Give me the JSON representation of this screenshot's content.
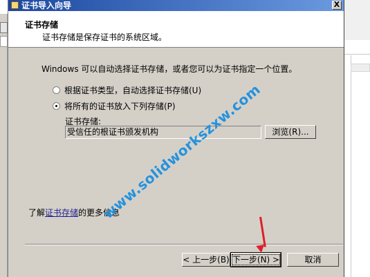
{
  "dialog": {
    "title": "证书导入向导",
    "close_label": "X"
  },
  "header": {
    "title": "证书存储",
    "subtitle": "证书存储是保存证书的系统区域。"
  },
  "body": {
    "intro": "Windows 可以自动选择证书存储，或者您可以为证书指定一个位置。",
    "options": [
      {
        "label": "根据证书类型，自动选择证书存储(U)",
        "checked": false
      },
      {
        "label": "将所有的证书放入下列存储(P)",
        "checked": true
      }
    ],
    "store_label": "证书存储:",
    "store_value": "受信任的根证书颁发机构",
    "browse_label": "浏览(R)..."
  },
  "learn_more": {
    "prefix": "了解",
    "link": "证书存储",
    "suffix": "的更多信息"
  },
  "buttons": {
    "back": "< 上一步(B)",
    "next": "下一步(N) >",
    "cancel": "取消"
  },
  "watermark": "www.solidworkszxw.com",
  "colors": {
    "titlebar_start": "#1c48a0",
    "titlebar_end": "#6c9ae0",
    "dialog_face": "#d4d0c8",
    "arrow": "#e01e2a",
    "watermark": "#1b8fe0"
  }
}
